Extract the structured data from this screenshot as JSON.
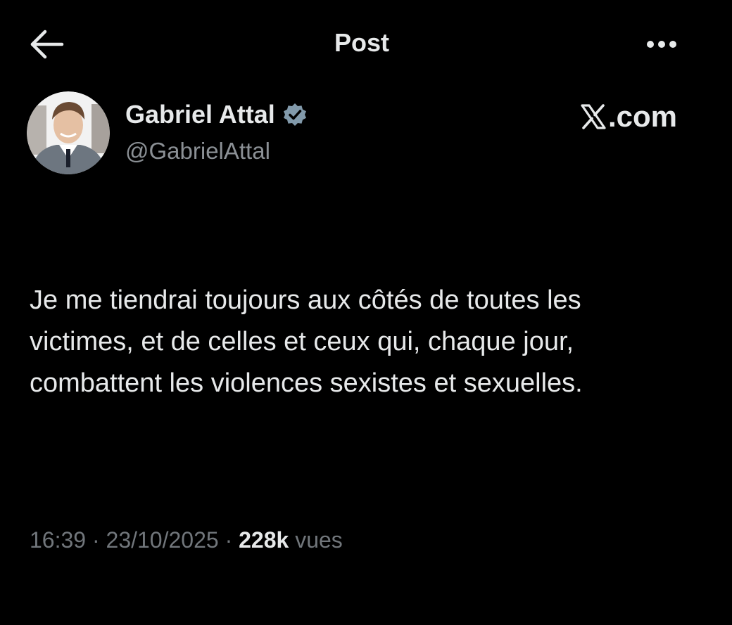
{
  "header": {
    "title": "Post",
    "back_icon": "arrow-left-icon",
    "more_icon": "more-horizontal-icon"
  },
  "author": {
    "display_name": "Gabriel Attal",
    "handle": "@GabrielAttal",
    "verified_icon": "verified-badge-icon",
    "verified_color": "#829aab",
    "avatar_icon": "avatar-photo"
  },
  "brand": {
    "x_icon": "x-logo-icon",
    "text": ".com"
  },
  "post": {
    "lines": [
      "Je me tiendrai toujours aux côtés de toutes les",
      "victimes, et de celles et ceux qui, chaque jour,",
      "combattent les violences sexistes et sexuelles."
    ]
  },
  "meta": {
    "time": "16:39",
    "separator": " · ",
    "date": "23/10/2025",
    "views_count": "228k",
    "views_label": "vues"
  },
  "colors": {
    "background": "#000000",
    "primary_text": "#e7e9ea",
    "secondary_text": "#71767b"
  }
}
